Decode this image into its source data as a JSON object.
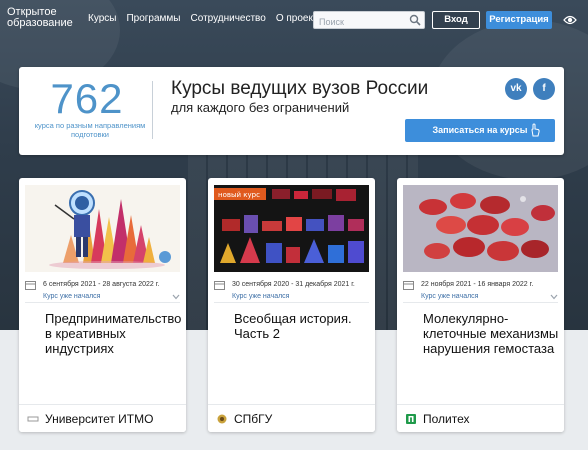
{
  "nav": {
    "logo_line1": "Открытое",
    "logo_line2": "образование",
    "links": [
      "Курсы",
      "Программы",
      "Сотрудничество",
      "О проекте"
    ],
    "search_placeholder": "Поиск",
    "login_label": "Вход",
    "register_label": "Регистрация"
  },
  "promo": {
    "count": "762",
    "count_desc": "курса по разным направлениям подготовки",
    "title": "Курсы ведущих вузов России",
    "subtitle": "для каждого без ограничений",
    "vk_label": "vk",
    "fb_label": "f",
    "enroll_label": "Записаться на курсы"
  },
  "courses": [
    {
      "dates": "6 сентября 2021 - 28 августа 2022 г.",
      "status": "Курс уже начался",
      "title": "Предпринимательство в креативных индустриях",
      "university": "Университет ИТМО",
      "badge": ""
    },
    {
      "dates": "30 сентября 2020 - 31 декабря 2021 г.",
      "status": "Курс уже начался",
      "title": "Всеобщая история. Часть 2",
      "university": "СПбГУ",
      "badge": "новый курс"
    },
    {
      "dates": "22 ноября 2021 - 16 января 2022 г.",
      "status": "Курс уже начался",
      "title": "Молекулярно-клеточные механизмы нарушения гемостаза",
      "university": "Политех",
      "badge": ""
    }
  ],
  "colors": {
    "accent": "#3d8edb",
    "stat": "#4e93c9",
    "status_link": "#3d6fa6",
    "hero_dark": "#2f3d4b"
  }
}
